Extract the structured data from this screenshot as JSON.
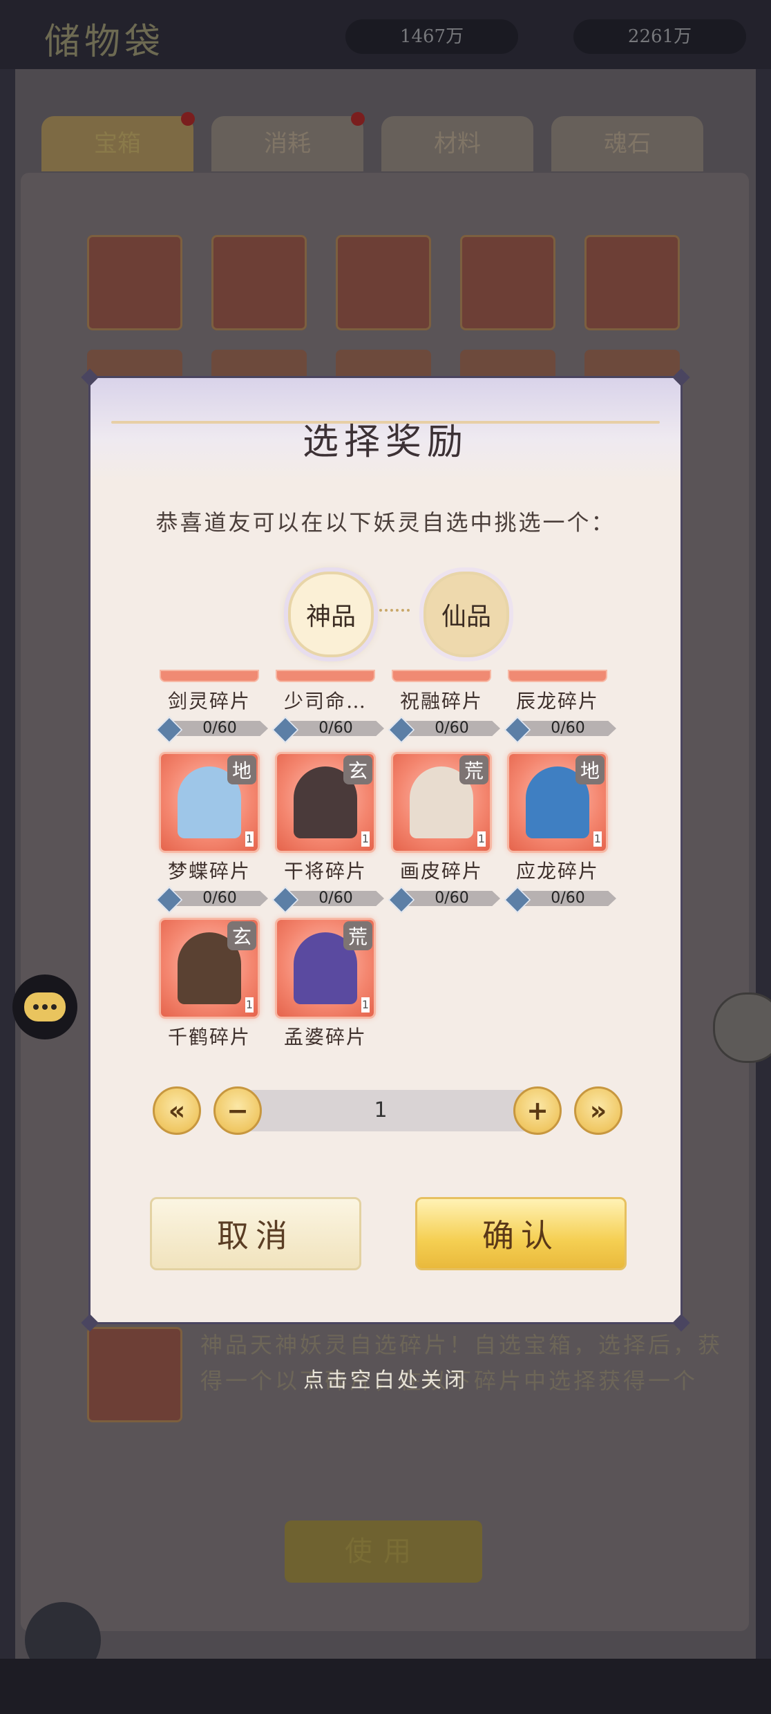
{
  "background": {
    "title": "储物袋",
    "resources": [
      "1467万",
      "2261万"
    ],
    "tabs": [
      "宝箱",
      "消耗",
      "材料",
      "魂石"
    ],
    "description": "神品天神妖灵自选碎片！自选宝箱，选择后，获得一个以下碎片，在以下碎片中选择获得一个",
    "use_button": "使用"
  },
  "dialog": {
    "title": "选择奖励",
    "subtitle": "恭喜道友可以在以下妖灵自选中挑选一个：",
    "tiers": [
      "神品",
      "仙品"
    ],
    "selected_tier": "神品",
    "items": [
      {
        "name": "剑灵碎片",
        "progress": "0/60",
        "clipped": true
      },
      {
        "name": "少司命…",
        "progress": "0/60",
        "clipped": true
      },
      {
        "name": "祝融碎片",
        "progress": "0/60",
        "clipped": true
      },
      {
        "name": "辰龙碎片",
        "progress": "0/60",
        "clipped": true
      },
      {
        "name": "梦蝶碎片",
        "progress": "0/60",
        "badge": "地",
        "count": "1",
        "portrait_color": "#9ec6e8"
      },
      {
        "name": "干将碎片",
        "progress": "0/60",
        "badge": "玄",
        "count": "1",
        "portrait_color": "#4a3a3a"
      },
      {
        "name": "画皮碎片",
        "progress": "0/60",
        "badge": "荒",
        "count": "1",
        "portrait_color": "#e8dccf"
      },
      {
        "name": "应龙碎片",
        "progress": "0/60",
        "badge": "地",
        "count": "1",
        "portrait_color": "#3f7fc2"
      },
      {
        "name": "千鹤碎片",
        "badge": "玄",
        "count": "1",
        "portrait_color": "#5a4132"
      },
      {
        "name": "孟婆碎片",
        "badge": "荒",
        "count": "1",
        "portrait_color": "#5a4aa0"
      }
    ],
    "stepper": {
      "value": "1",
      "first": "«",
      "minus": "−",
      "plus": "+",
      "last": "»"
    },
    "cancel": "取消",
    "confirm": "确认"
  },
  "hint": "点击空白处关闭",
  "colors": {
    "accent_gold": "#f0c865",
    "fragment_frame": "#f4866f",
    "progress_bar": "#b7b1b1"
  }
}
